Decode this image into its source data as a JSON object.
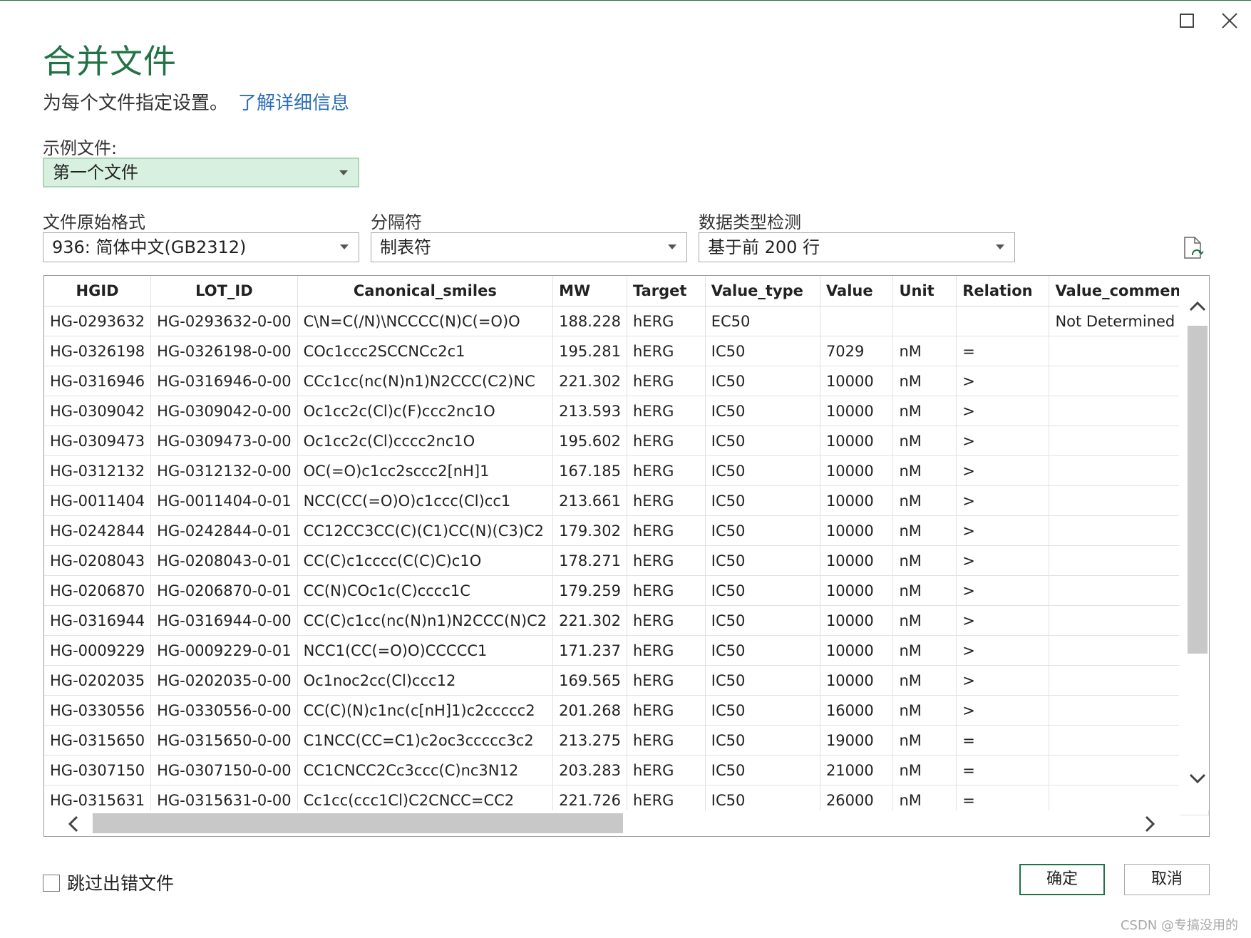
{
  "dialog": {
    "title": "合并文件",
    "subtitle": "为每个文件指定设置。",
    "learn_more": "了解详细信息"
  },
  "sample_file": {
    "label": "示例文件:",
    "value": "第一个文件"
  },
  "file_origin": {
    "label": "文件原始格式",
    "value": "936: 简体中文(GB2312)"
  },
  "delimiter": {
    "label": "分隔符",
    "value": "制表符"
  },
  "type_detection": {
    "label": "数据类型检测",
    "value": "基于前 200 行"
  },
  "table": {
    "columns": [
      "HGID",
      "LOT_ID",
      "Canonical_smiles",
      "MW",
      "Target",
      "Value_type",
      "Value",
      "Unit",
      "Relation",
      "Value_comments"
    ],
    "rows": [
      [
        "HG-0293632",
        "HG-0293632-0-00",
        "C\\N=C(/N)\\NCCCC(N)C(=O)O",
        "188.228",
        "hERG",
        "EC50",
        "",
        "",
        "",
        "Not Determined"
      ],
      [
        "HG-0326198",
        "HG-0326198-0-00",
        "COc1ccc2SCCNCc2c1",
        "195.281",
        "hERG",
        "IC50",
        "7029",
        "nM",
        "=",
        ""
      ],
      [
        "HG-0316946",
        "HG-0316946-0-00",
        "CCc1cc(nc(N)n1)N2CCC(C2)NC",
        "221.302",
        "hERG",
        "IC50",
        "10000",
        "nM",
        ">",
        ""
      ],
      [
        "HG-0309042",
        "HG-0309042-0-00",
        "Oc1cc2c(Cl)c(F)ccc2nc1O",
        "213.593",
        "hERG",
        "IC50",
        "10000",
        "nM",
        ">",
        ""
      ],
      [
        "HG-0309473",
        "HG-0309473-0-00",
        "Oc1cc2c(Cl)cccc2nc1O",
        "195.602",
        "hERG",
        "IC50",
        "10000",
        "nM",
        ">",
        ""
      ],
      [
        "HG-0312132",
        "HG-0312132-0-00",
        "OC(=O)c1cc2sccc2[nH]1",
        "167.185",
        "hERG",
        "IC50",
        "10000",
        "nM",
        ">",
        ""
      ],
      [
        "HG-0011404",
        "HG-0011404-0-01",
        "NCC(CC(=O)O)c1ccc(Cl)cc1",
        "213.661",
        "hERG",
        "IC50",
        "10000",
        "nM",
        ">",
        ""
      ],
      [
        "HG-0242844",
        "HG-0242844-0-01",
        "CC12CC3CC(C)(C1)CC(N)(C3)C2",
        "179.302",
        "hERG",
        "IC50",
        "10000",
        "nM",
        ">",
        ""
      ],
      [
        "HG-0208043",
        "HG-0208043-0-01",
        "CC(C)c1cccc(C(C)C)c1O",
        "178.271",
        "hERG",
        "IC50",
        "10000",
        "nM",
        ">",
        ""
      ],
      [
        "HG-0206870",
        "HG-0206870-0-01",
        "CC(N)COc1c(C)cccc1C",
        "179.259",
        "hERG",
        "IC50",
        "10000",
        "nM",
        ">",
        ""
      ],
      [
        "HG-0316944",
        "HG-0316944-0-00",
        "CC(C)c1cc(nc(N)n1)N2CCC(N)C2",
        "221.302",
        "hERG",
        "IC50",
        "10000",
        "nM",
        ">",
        ""
      ],
      [
        "HG-0009229",
        "HG-0009229-0-01",
        "NCC1(CC(=O)O)CCCCC1",
        "171.237",
        "hERG",
        "IC50",
        "10000",
        "nM",
        ">",
        ""
      ],
      [
        "HG-0202035",
        "HG-0202035-0-00",
        "Oc1noc2cc(Cl)ccc12",
        "169.565",
        "hERG",
        "IC50",
        "10000",
        "nM",
        ">",
        ""
      ],
      [
        "HG-0330556",
        "HG-0330556-0-00",
        "CC(C)(N)c1nc(c[nH]1)c2ccccc2",
        "201.268",
        "hERG",
        "IC50",
        "16000",
        "nM",
        ">",
        ""
      ],
      [
        "HG-0315650",
        "HG-0315650-0-00",
        "C1NCC(CC=C1)c2oc3ccccc3c2",
        "213.275",
        "hERG",
        "IC50",
        "19000",
        "nM",
        "=",
        ""
      ],
      [
        "HG-0307150",
        "HG-0307150-0-00",
        "CC1CNCC2Cc3ccc(C)nc3N12",
        "203.283",
        "hERG",
        "IC50",
        "21000",
        "nM",
        "=",
        ""
      ],
      [
        "HG-0315631",
        "HG-0315631-0-00",
        "Cc1cc(ccc1Cl)C2CNCC=CC2",
        "221.726",
        "hERG",
        "IC50",
        "26000",
        "nM",
        "=",
        ""
      ]
    ]
  },
  "skip_errors": {
    "label": "跳过出错文件",
    "checked": false
  },
  "buttons": {
    "ok": "确定",
    "cancel": "取消"
  },
  "watermark": "CSDN @专搞没用的",
  "colors": {
    "accent": "#217346",
    "link": "#2a6eb8",
    "selected_bg": "#d7f0df"
  }
}
